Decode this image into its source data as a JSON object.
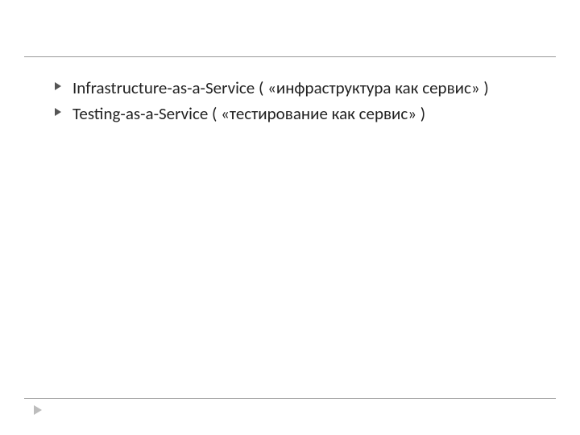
{
  "bullets": [
    {
      "text": "Infrastructure-as-a-Service ( «инфраструктура как сервис» )"
    },
    {
      "text": "Testing-as-a-Service ( «тестирование как сервис» )"
    }
  ]
}
